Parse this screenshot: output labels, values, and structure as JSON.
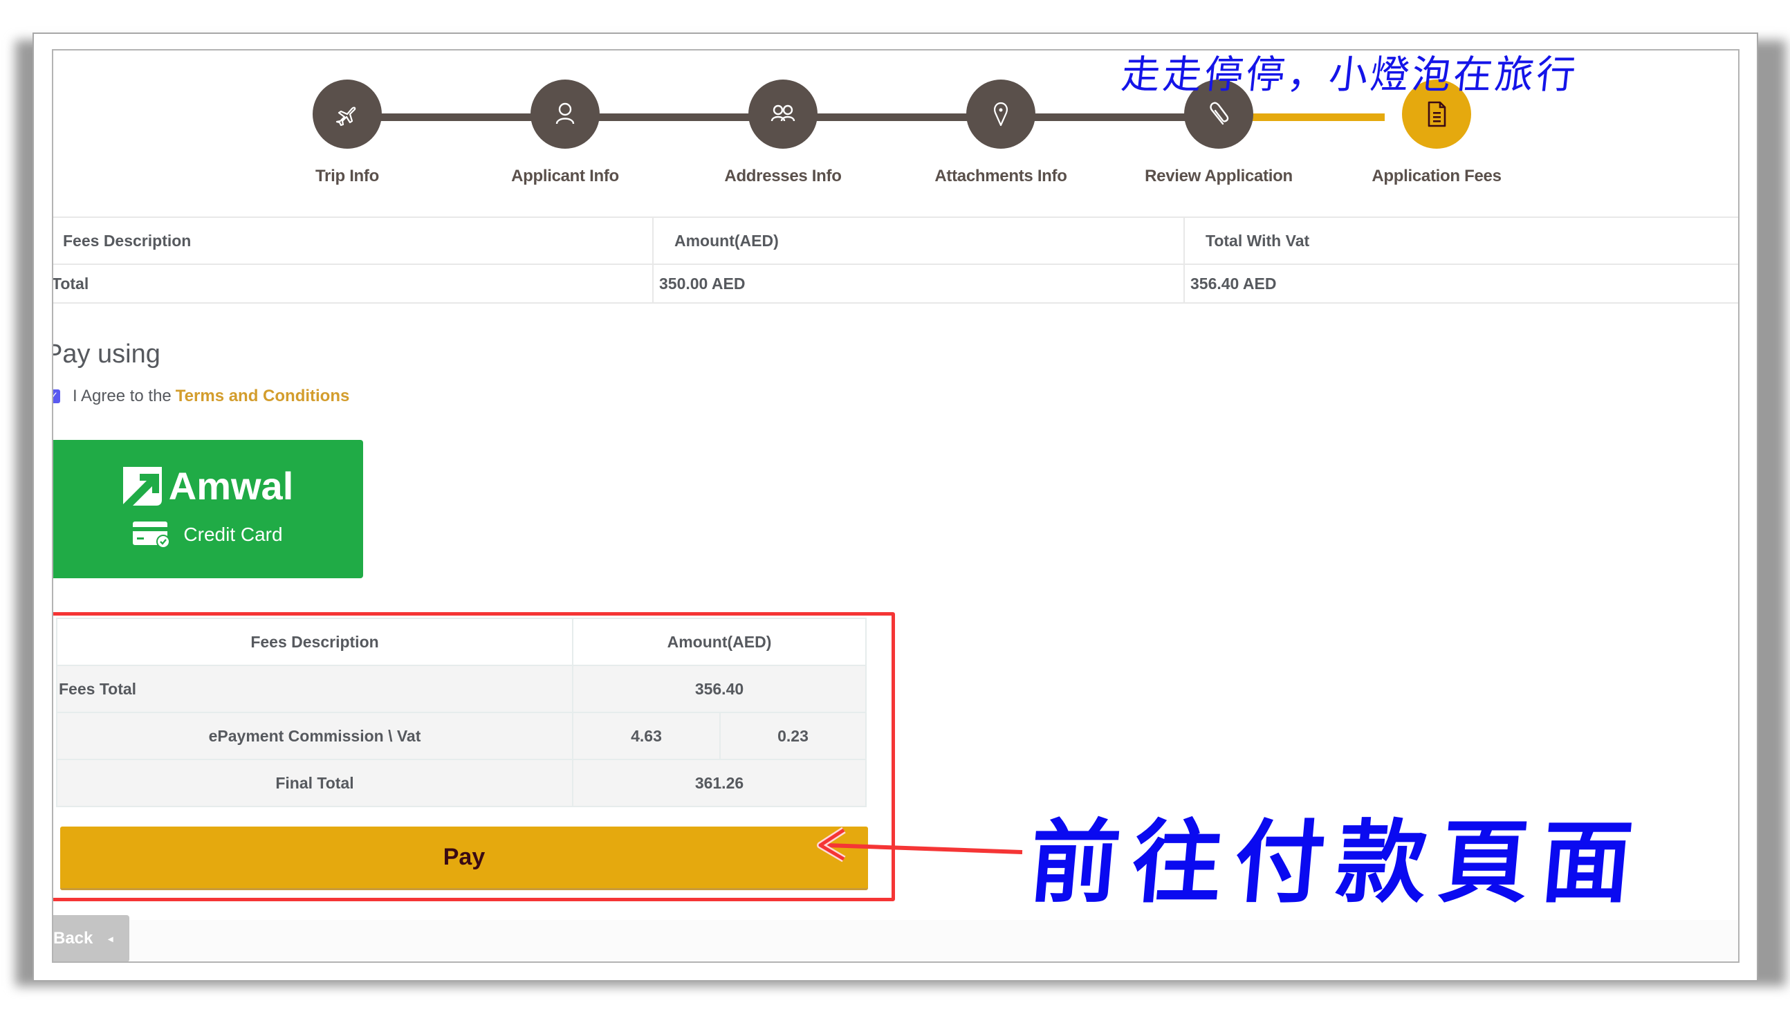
{
  "stepper": {
    "steps": [
      {
        "label": "Trip Info",
        "icon": "airplane-icon",
        "active": false
      },
      {
        "label": "Applicant Info",
        "icon": "user-icon",
        "active": false
      },
      {
        "label": "Addresses Info",
        "icon": "users-icon",
        "active": false
      },
      {
        "label": "Attachments Info",
        "icon": "map-pin-icon",
        "active": false
      },
      {
        "label": "Review Application",
        "icon": "paperclip-icon",
        "active": false
      },
      {
        "label": "Application Fees",
        "icon": "document-icon",
        "active": true
      }
    ]
  },
  "fees_table": {
    "headers": [
      "Fees Description",
      "Amount(AED)",
      "Total With Vat"
    ],
    "rows": [
      [
        "Total",
        "350.00 AED",
        "356.40 AED"
      ]
    ]
  },
  "payment": {
    "heading": "Pay using",
    "agree_checked": true,
    "agree_text": "I Agree to the",
    "terms_link": "Terms and Conditions",
    "provider_name": "Amwal",
    "provider_method": "Credit Card"
  },
  "summary_table": {
    "headers": [
      "Fees Description",
      "Amount(AED)"
    ],
    "fees_total_label": "Fees Total",
    "fees_total_value": "356.40",
    "commission_label": "ePayment Commission \\ Vat",
    "commission_value": "4.63",
    "vat_value": "0.23",
    "final_total_label": "Final Total",
    "final_total_value": "361.26"
  },
  "buttons": {
    "pay": "Pay",
    "back": "Back",
    "back_caret": "◂"
  },
  "annotations": {
    "top": "走走停停，小燈泡在旅行",
    "bottom": "前往付款頁面"
  },
  "colors": {
    "step_inactive": "#5a504b",
    "step_active": "#e5a90e",
    "amwal_green": "#20ab46",
    "highlight_red": "#f53535",
    "terms_link": "#d39d2d",
    "annotation_blue": "#1414e8"
  }
}
